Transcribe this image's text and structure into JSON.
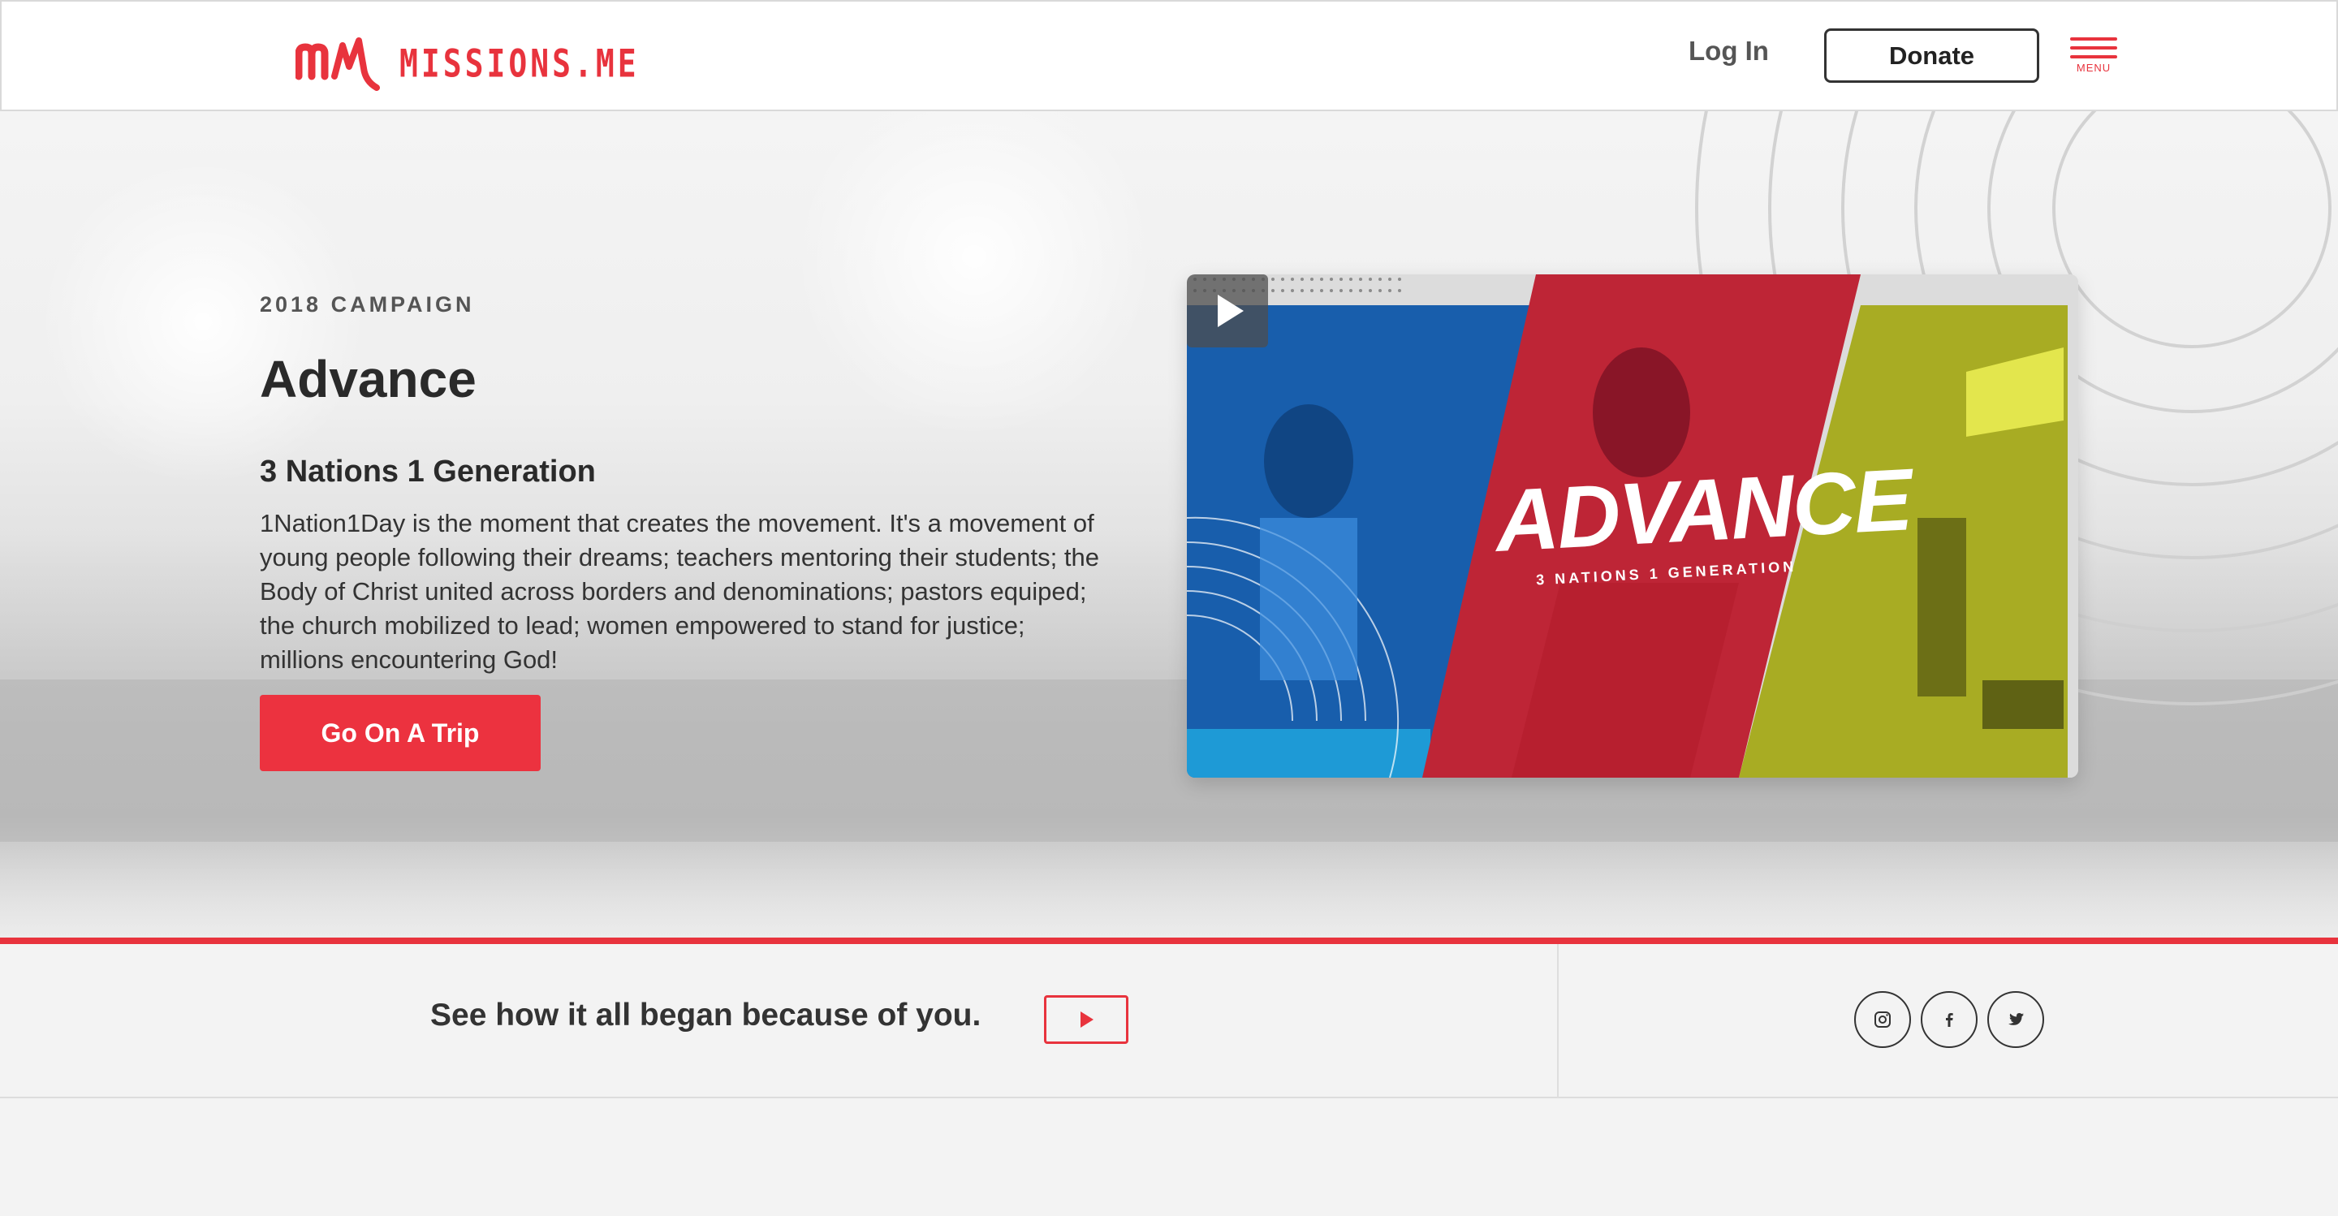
{
  "header": {
    "logo_text": "MISSIONS.ME",
    "login_label": "Log In",
    "donate_label": "Donate",
    "menu_label": "MENU"
  },
  "hero": {
    "eyebrow": "2018 CAMPAIGN",
    "title": "Advance",
    "subtitle": "3 Nations 1 Generation",
    "description": "1Nation1Day is the moment that creates the movement. It's a movement of young people following their dreams; teachers mentoring their students; the Body of Christ united across borders and denominations; pastors equiped; the church mobilized to lead; women empowered to stand for justice; millions encountering God!",
    "cta_label": "Go On A Trip"
  },
  "video": {
    "title_text": "ADVANCE",
    "subtitle_text": "3 NATIONS 1 GENERATION",
    "play_icon": "play-icon"
  },
  "bottom": {
    "tagline": "See how it all began because of you.",
    "play_icon": "play-icon",
    "socials": [
      "instagram-icon",
      "facebook-icon",
      "twitter-icon"
    ]
  },
  "colors": {
    "accent": "#e8333d",
    "text": "#2b2b2b",
    "background": "#f3f3f3"
  }
}
